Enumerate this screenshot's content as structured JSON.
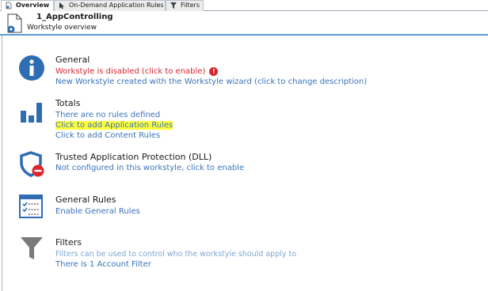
{
  "tabs": [
    {
      "label": "Overview",
      "icon": "document-gear-icon"
    },
    {
      "label": "On-Demand Application Rules",
      "icon": "cursor-icon"
    },
    {
      "label": "Filters",
      "icon": "funnel-icon"
    }
  ],
  "header": {
    "title": "1_AppControlling",
    "subtitle": "Workstyle overview"
  },
  "sections": {
    "general": {
      "title": "General",
      "status": "Workstyle is disabled (click to enable)",
      "description": "New Workstyle created with the Workstyle wizard (click to change description)"
    },
    "totals": {
      "title": "Totals",
      "no_rules": "There are no rules defined",
      "add_app_rules": "Click to add Application Rules",
      "add_content_rules": "Click to add Content Rules"
    },
    "tap": {
      "title": "Trusted Application Protection (DLL)",
      "status": "Not configured in this workstyle, click to enable"
    },
    "general_rules": {
      "title": "General Rules",
      "enable": "Enable General Rules"
    },
    "filters": {
      "title": "Filters",
      "info": "Filters can be used to control who the workstyle should apply to",
      "account_filter": "There is 1 Account Filter"
    }
  },
  "colors": {
    "link": "#3b73b9",
    "error": "#d9262f",
    "icon_blue": "#2f6db3",
    "highlight": "#ffff3b"
  }
}
